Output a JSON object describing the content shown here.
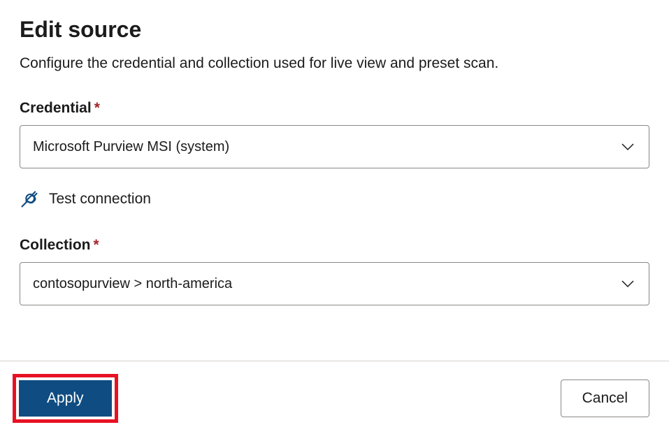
{
  "header": {
    "title": "Edit source",
    "description": "Configure the credential and collection used for live view and preset scan."
  },
  "fields": {
    "credential": {
      "label": "Credential",
      "required_marker": "*",
      "value": "Microsoft Purview MSI (system)"
    },
    "collection": {
      "label": "Collection",
      "required_marker": "*",
      "value": "contosopurview > north-america"
    }
  },
  "actions": {
    "test_connection": "Test connection",
    "apply": "Apply",
    "cancel": "Cancel"
  },
  "colors": {
    "primary_button": "#0f4c81",
    "highlight_border": "#e81123",
    "required": "#a4262c",
    "icon_blue": "#0f4c81"
  }
}
